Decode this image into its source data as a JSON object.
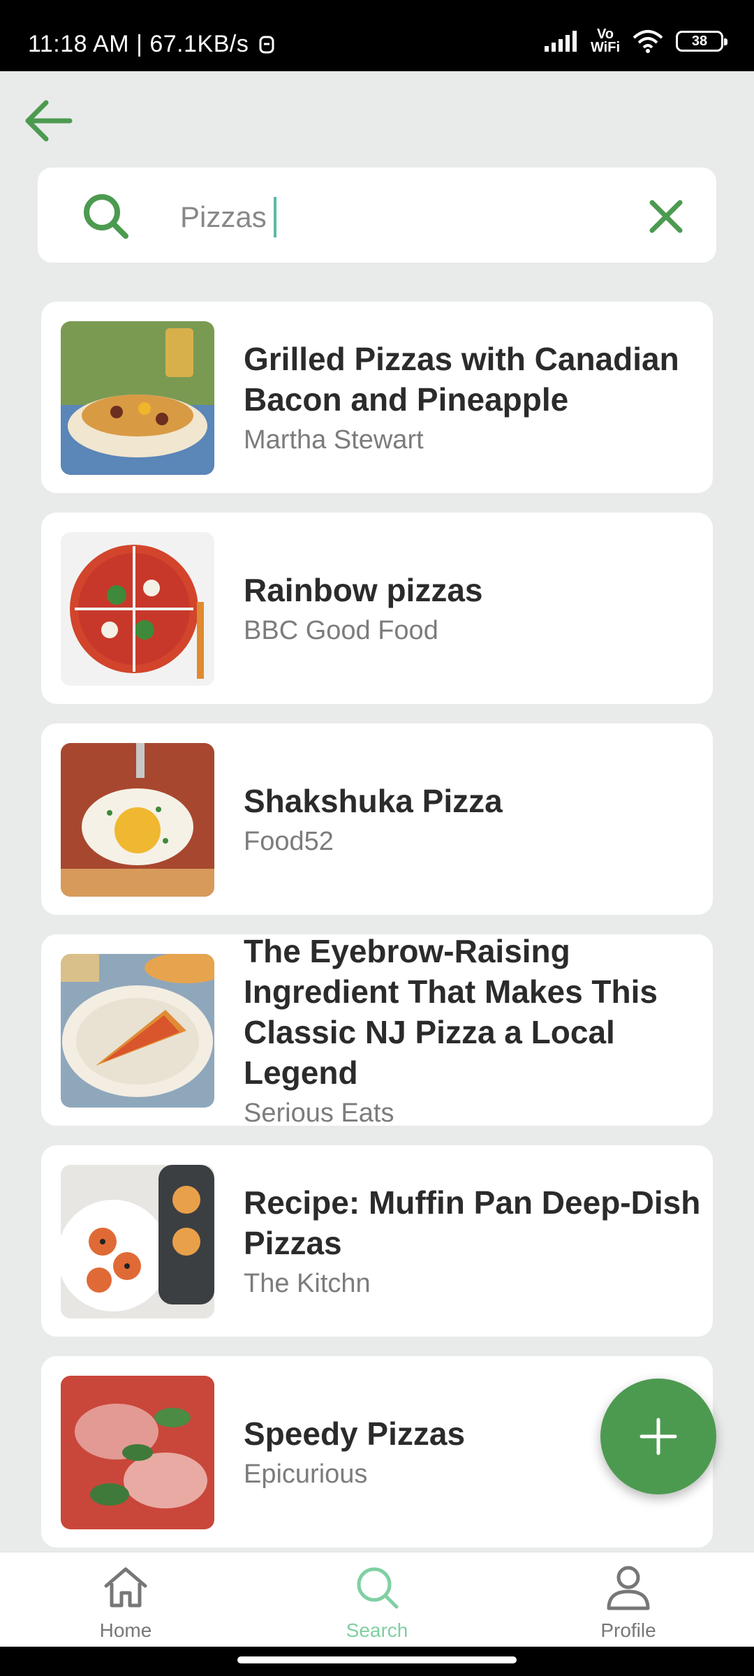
{
  "status_bar": {
    "time_speed": "11:18 AM | 67.1KB/s",
    "vowifi_top": "Vo",
    "vowifi_bottom": "WiFi",
    "battery": "38"
  },
  "search": {
    "query": "Pizzas"
  },
  "results": [
    {
      "title": "Grilled Pizzas with Canadian Bacon and Pineapple",
      "source": "Martha Stewart"
    },
    {
      "title": "Rainbow pizzas",
      "source": "BBC Good Food"
    },
    {
      "title": "Shakshuka Pizza",
      "source": "Food52"
    },
    {
      "title": "The Eyebrow-Raising Ingredient That Makes This Classic NJ Pizza a Local Legend",
      "source": "Serious Eats"
    },
    {
      "title": "Recipe: Muffin Pan Deep-Dish Pizzas",
      "source": "The Kitchn"
    },
    {
      "title": "Speedy Pizzas",
      "source": "Epicurious"
    }
  ],
  "bottom_nav": {
    "home": "Home",
    "search": "Search",
    "profile": "Profile"
  },
  "colors": {
    "accent": "#4c9a50",
    "active_tab": "#7fd0a2",
    "inactive_tab": "#777777"
  }
}
